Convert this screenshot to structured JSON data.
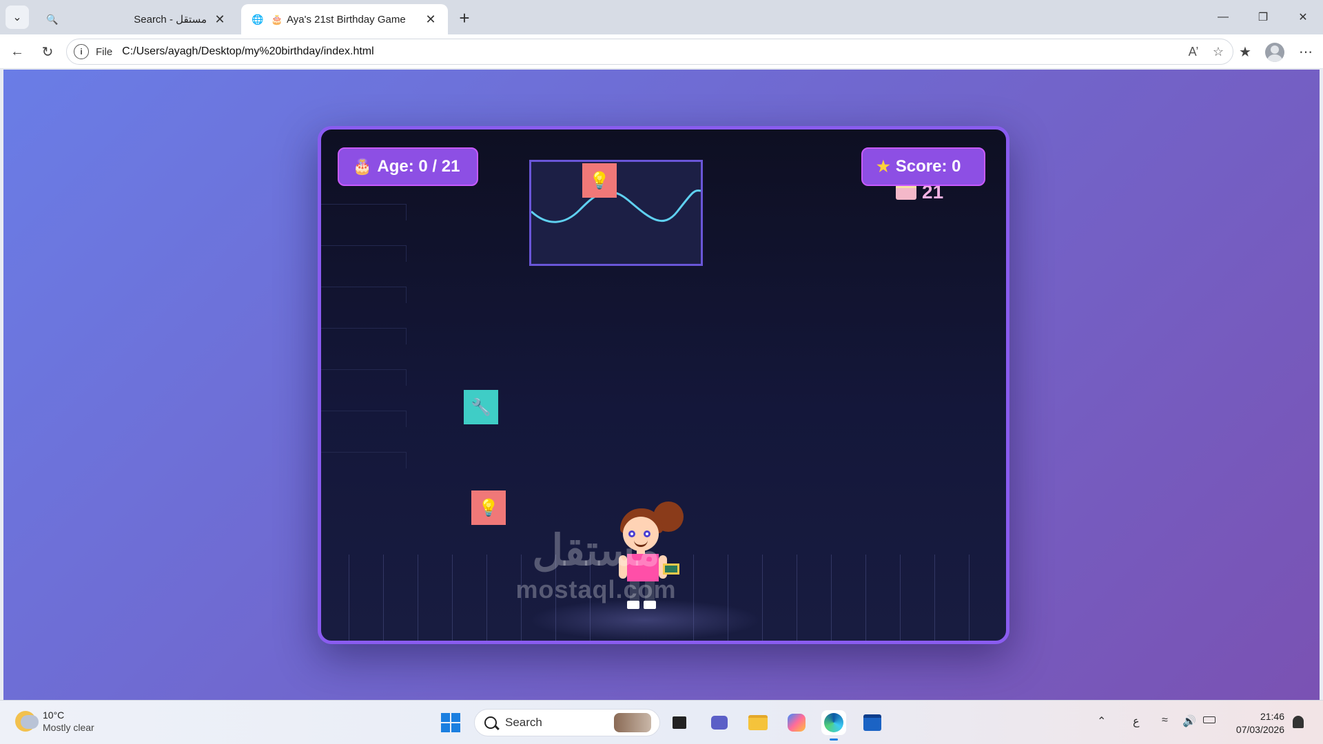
{
  "browser": {
    "tabs": [
      {
        "title": "Search - مستقل",
        "favicon": "search-icon"
      },
      {
        "title": "Aya's 21st Birthday Game",
        "favicon": "cake-icon",
        "active": true
      }
    ],
    "address": {
      "scheme": "File",
      "url": "C:/Users/ayagh/Desktop/my%20birthday/index.html"
    }
  },
  "game": {
    "age_label": "Age: 0 / 21",
    "score_label": "Score: 0",
    "floating_text": "21",
    "tiles": [
      {
        "type": "bulb",
        "icon": "lightbulb-icon"
      },
      {
        "type": "wrench",
        "icon": "wrench-icon"
      },
      {
        "type": "bulb",
        "icon": "lightbulb-icon"
      }
    ],
    "colors": {
      "frame": "#8a5cf0",
      "hud": "#8d4fe4",
      "bulb_tile": "#f07878",
      "wrench_tile": "#3fcdc6",
      "wave": "#5fd0f0"
    }
  },
  "watermark": {
    "arabic": "مستقل",
    "latin": "mostaql.com"
  },
  "taskbar": {
    "weather": {
      "temp": "10°C",
      "desc": "Mostly clear"
    },
    "search_placeholder": "Search",
    "tray": {
      "lang": "ع"
    },
    "clock": {
      "time": "21:46",
      "date": "07/03/2026"
    }
  }
}
